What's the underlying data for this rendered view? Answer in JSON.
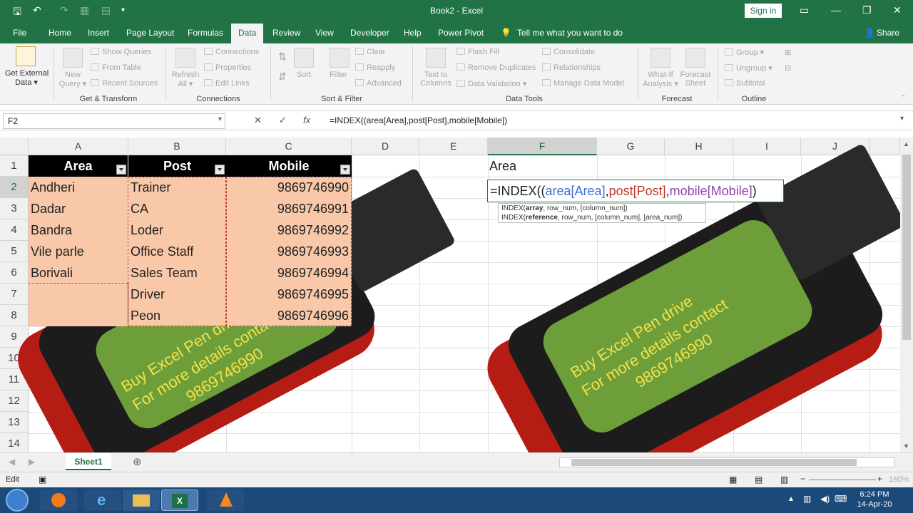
{
  "window": {
    "title": "Book2 - Excel",
    "signin": "Sign in"
  },
  "tabs": [
    "File",
    "Home",
    "Insert",
    "Page Layout",
    "Formulas",
    "Data",
    "Review",
    "View",
    "Developer",
    "Help",
    "Power Pivot"
  ],
  "tellme": "Tell me what you want to do",
  "share": "Share",
  "ribbon": {
    "get_external": [
      "Get External",
      "Data ▾"
    ],
    "new_query": [
      "New",
      "Query ▾"
    ],
    "show_queries": "Show Queries",
    "from_table": "From Table",
    "recent_sources": "Recent Sources",
    "refresh_all": [
      "Refresh",
      "All ▾"
    ],
    "connections": "Connections",
    "properties": "Properties",
    "edit_links": "Edit Links",
    "sort": "Sort",
    "filter": "Filter",
    "clear": "Clear",
    "reapply": "Reapply",
    "advanced": "Advanced",
    "text_to_columns": [
      "Text to",
      "Columns"
    ],
    "flash_fill": "Flash Fill",
    "remove_duplicates": "Remove Duplicates",
    "data_validation": "Data Validation ▾",
    "consolidate": "Consolidate",
    "relationships": "Relationships",
    "manage_data_model": "Manage Data Model",
    "what_if": [
      "What-If",
      "Analysis ▾"
    ],
    "forecast_sheet": [
      "Forecast",
      "Sheet"
    ],
    "group": "Group ▾",
    "ungroup": "Ungroup ▾",
    "subtotal": "Subtotal",
    "groups": {
      "get_transform": "Get & Transform",
      "connections": "Connections",
      "sort_filter": "Sort & Filter",
      "data_tools": "Data Tools",
      "forecast": "Forecast",
      "outline": "Outline"
    }
  },
  "formula_bar": {
    "name_box": "F2",
    "formula": "=INDEX((area[Area],post[Post],mobile[Mobile])"
  },
  "columns": [
    "A",
    "B",
    "C",
    "D",
    "E",
    "F",
    "G",
    "H",
    "I",
    "J"
  ],
  "rows": [
    "1",
    "2",
    "3",
    "4",
    "5",
    "6",
    "7",
    "8",
    "9",
    "10",
    "11",
    "12",
    "13",
    "14"
  ],
  "table": {
    "headers": [
      "Area",
      "Post",
      "Mobile"
    ],
    "area": [
      "Andheri",
      "Dadar",
      "Bandra",
      "Vile parle",
      "Borivali",
      "",
      ""
    ],
    "post": [
      "Trainer",
      "CA",
      "Loder",
      "Office Staff",
      "Sales Team",
      "Driver",
      "Peon"
    ],
    "mobile": [
      "9869746990",
      "9869746991",
      "9869746992",
      "9869746993",
      "9869746994",
      "9869746995",
      "9869746996"
    ]
  },
  "f1": "Area",
  "edit": {
    "prefix": "=INDEX((",
    "area_ref": "area[Area]",
    "comma1": ",",
    "post_ref": "post[Post]",
    "comma2": ",",
    "mobile_ref": "mobile[Mobile]",
    "close": ")"
  },
  "tooltip": {
    "line1_fn": "INDEX(",
    "line1_bold": "array",
    "line1_rest": ", row_num, [column_num])",
    "line2_fn": "INDEX(",
    "line2_bold": "reference",
    "line2_rest": ", row_num, [column_num], [area_num])"
  },
  "promo_left": {
    "line1": "Buy Excel Pen drive",
    "line2": "For more details contact",
    "line3": "9869746990"
  },
  "promo_right": {
    "line1": "Buy Excel Pen drive",
    "line2": "For more details contact",
    "line3": "9869746990"
  },
  "sheet_tab": "Sheet1",
  "status": {
    "mode": "Edit",
    "zoom": "160%"
  },
  "clock": {
    "time": "6:24 PM",
    "date": "14-Apr-20"
  },
  "colors": {
    "excel_green": "#217346",
    "header_black": "#000000",
    "cell_fill": "#f8c8a8",
    "ref_blue": "#3b6ed6",
    "ref_red": "#c0392b",
    "ref_purple": "#8e44ad"
  }
}
